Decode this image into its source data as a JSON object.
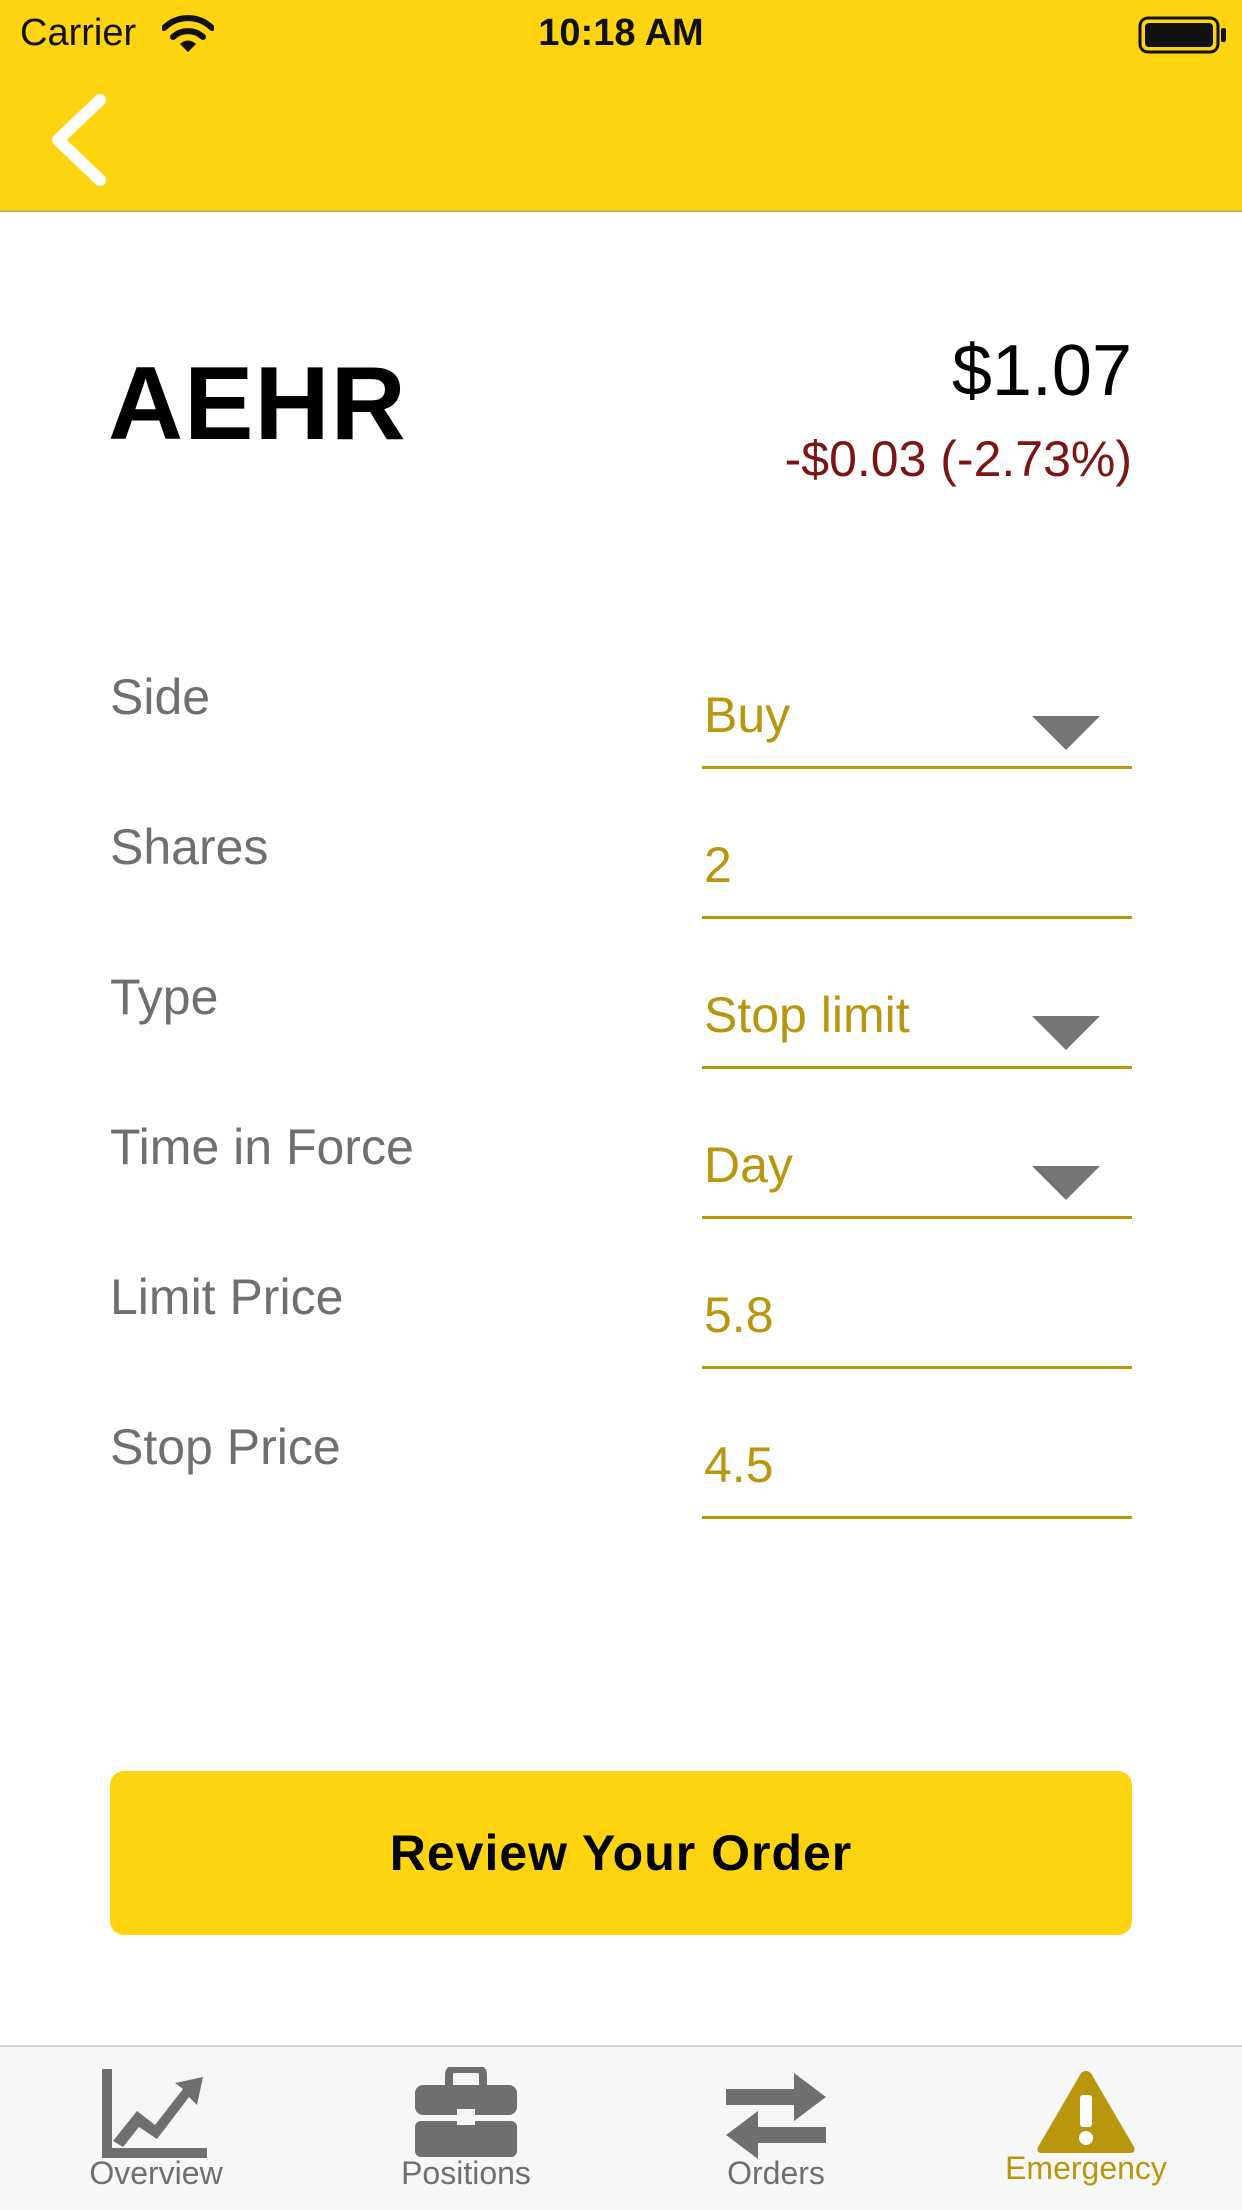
{
  "status_bar": {
    "carrier": "Carrier",
    "time": "10:18 AM"
  },
  "stock": {
    "symbol": "AEHR",
    "price": "$1.07",
    "change": "-$0.03 (-2.73%)"
  },
  "form": {
    "side": {
      "label": "Side",
      "value": "Buy"
    },
    "shares": {
      "label": "Shares",
      "value": "2"
    },
    "type": {
      "label": "Type",
      "value": "Stop limit"
    },
    "time_in_force": {
      "label": "Time in Force",
      "value": "Day"
    },
    "limit_price": {
      "label": "Limit Price",
      "value": "5.8"
    },
    "stop_price": {
      "label": "Stop Price",
      "value": "4.5"
    }
  },
  "review_button": "Review Your Order",
  "tabs": [
    {
      "label": "Overview",
      "icon": "chart-icon"
    },
    {
      "label": "Positions",
      "icon": "briefcase-icon"
    },
    {
      "label": "Orders",
      "icon": "swap-arrows-icon"
    },
    {
      "label": "Emergency",
      "icon": "warning-icon",
      "active": true
    }
  ],
  "colors": {
    "brand_yellow": "#FDD40F",
    "accent_gold": "#B8970F",
    "negative": "#7a1616"
  }
}
